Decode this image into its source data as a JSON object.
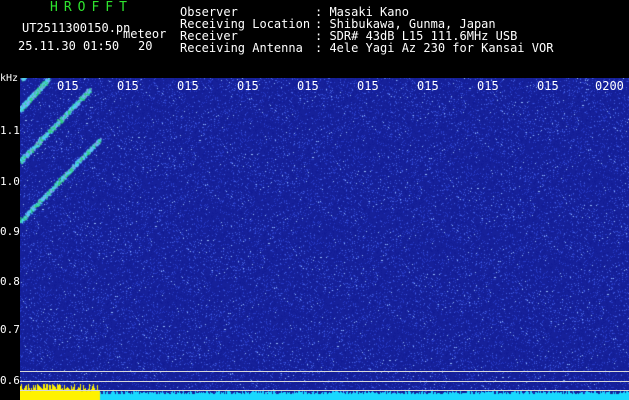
{
  "header": {
    "app_title": "HROFFT",
    "filename": "UT2511300150.pn",
    "meteor_label": "meteor",
    "datetime": "25.11.30 01:50",
    "count": "20",
    "fields": [
      {
        "key": "Observer",
        "value": ": Masaki Kano"
      },
      {
        "key": "Receiving Location",
        "value": ": Shibukawa, Gunma, Japan"
      },
      {
        "key": "Receiver",
        "value": ": SDR# 43dB L15 111.6MHz USB"
      },
      {
        "key": "Receiving Antenna",
        "value": ": 4ele Yagi Az 230 for Kansai VOR"
      }
    ]
  },
  "spectrogram": {
    "axis_unit": "kHz",
    "y_labels": [
      "1.1",
      "1.0",
      "0.9",
      "0.8",
      "0.7",
      "0.6"
    ],
    "time_labels": [
      "015",
      "015",
      "015",
      "015",
      "015",
      "015",
      "015",
      "015",
      "015",
      "0200"
    ],
    "colors": {
      "background": "#16219a",
      "noise_light": "#5a73e6",
      "meteor_trail": "#4fd0ff",
      "bottom_strip": "#19d9ff",
      "bottom_yellow": "#fff200"
    }
  }
}
